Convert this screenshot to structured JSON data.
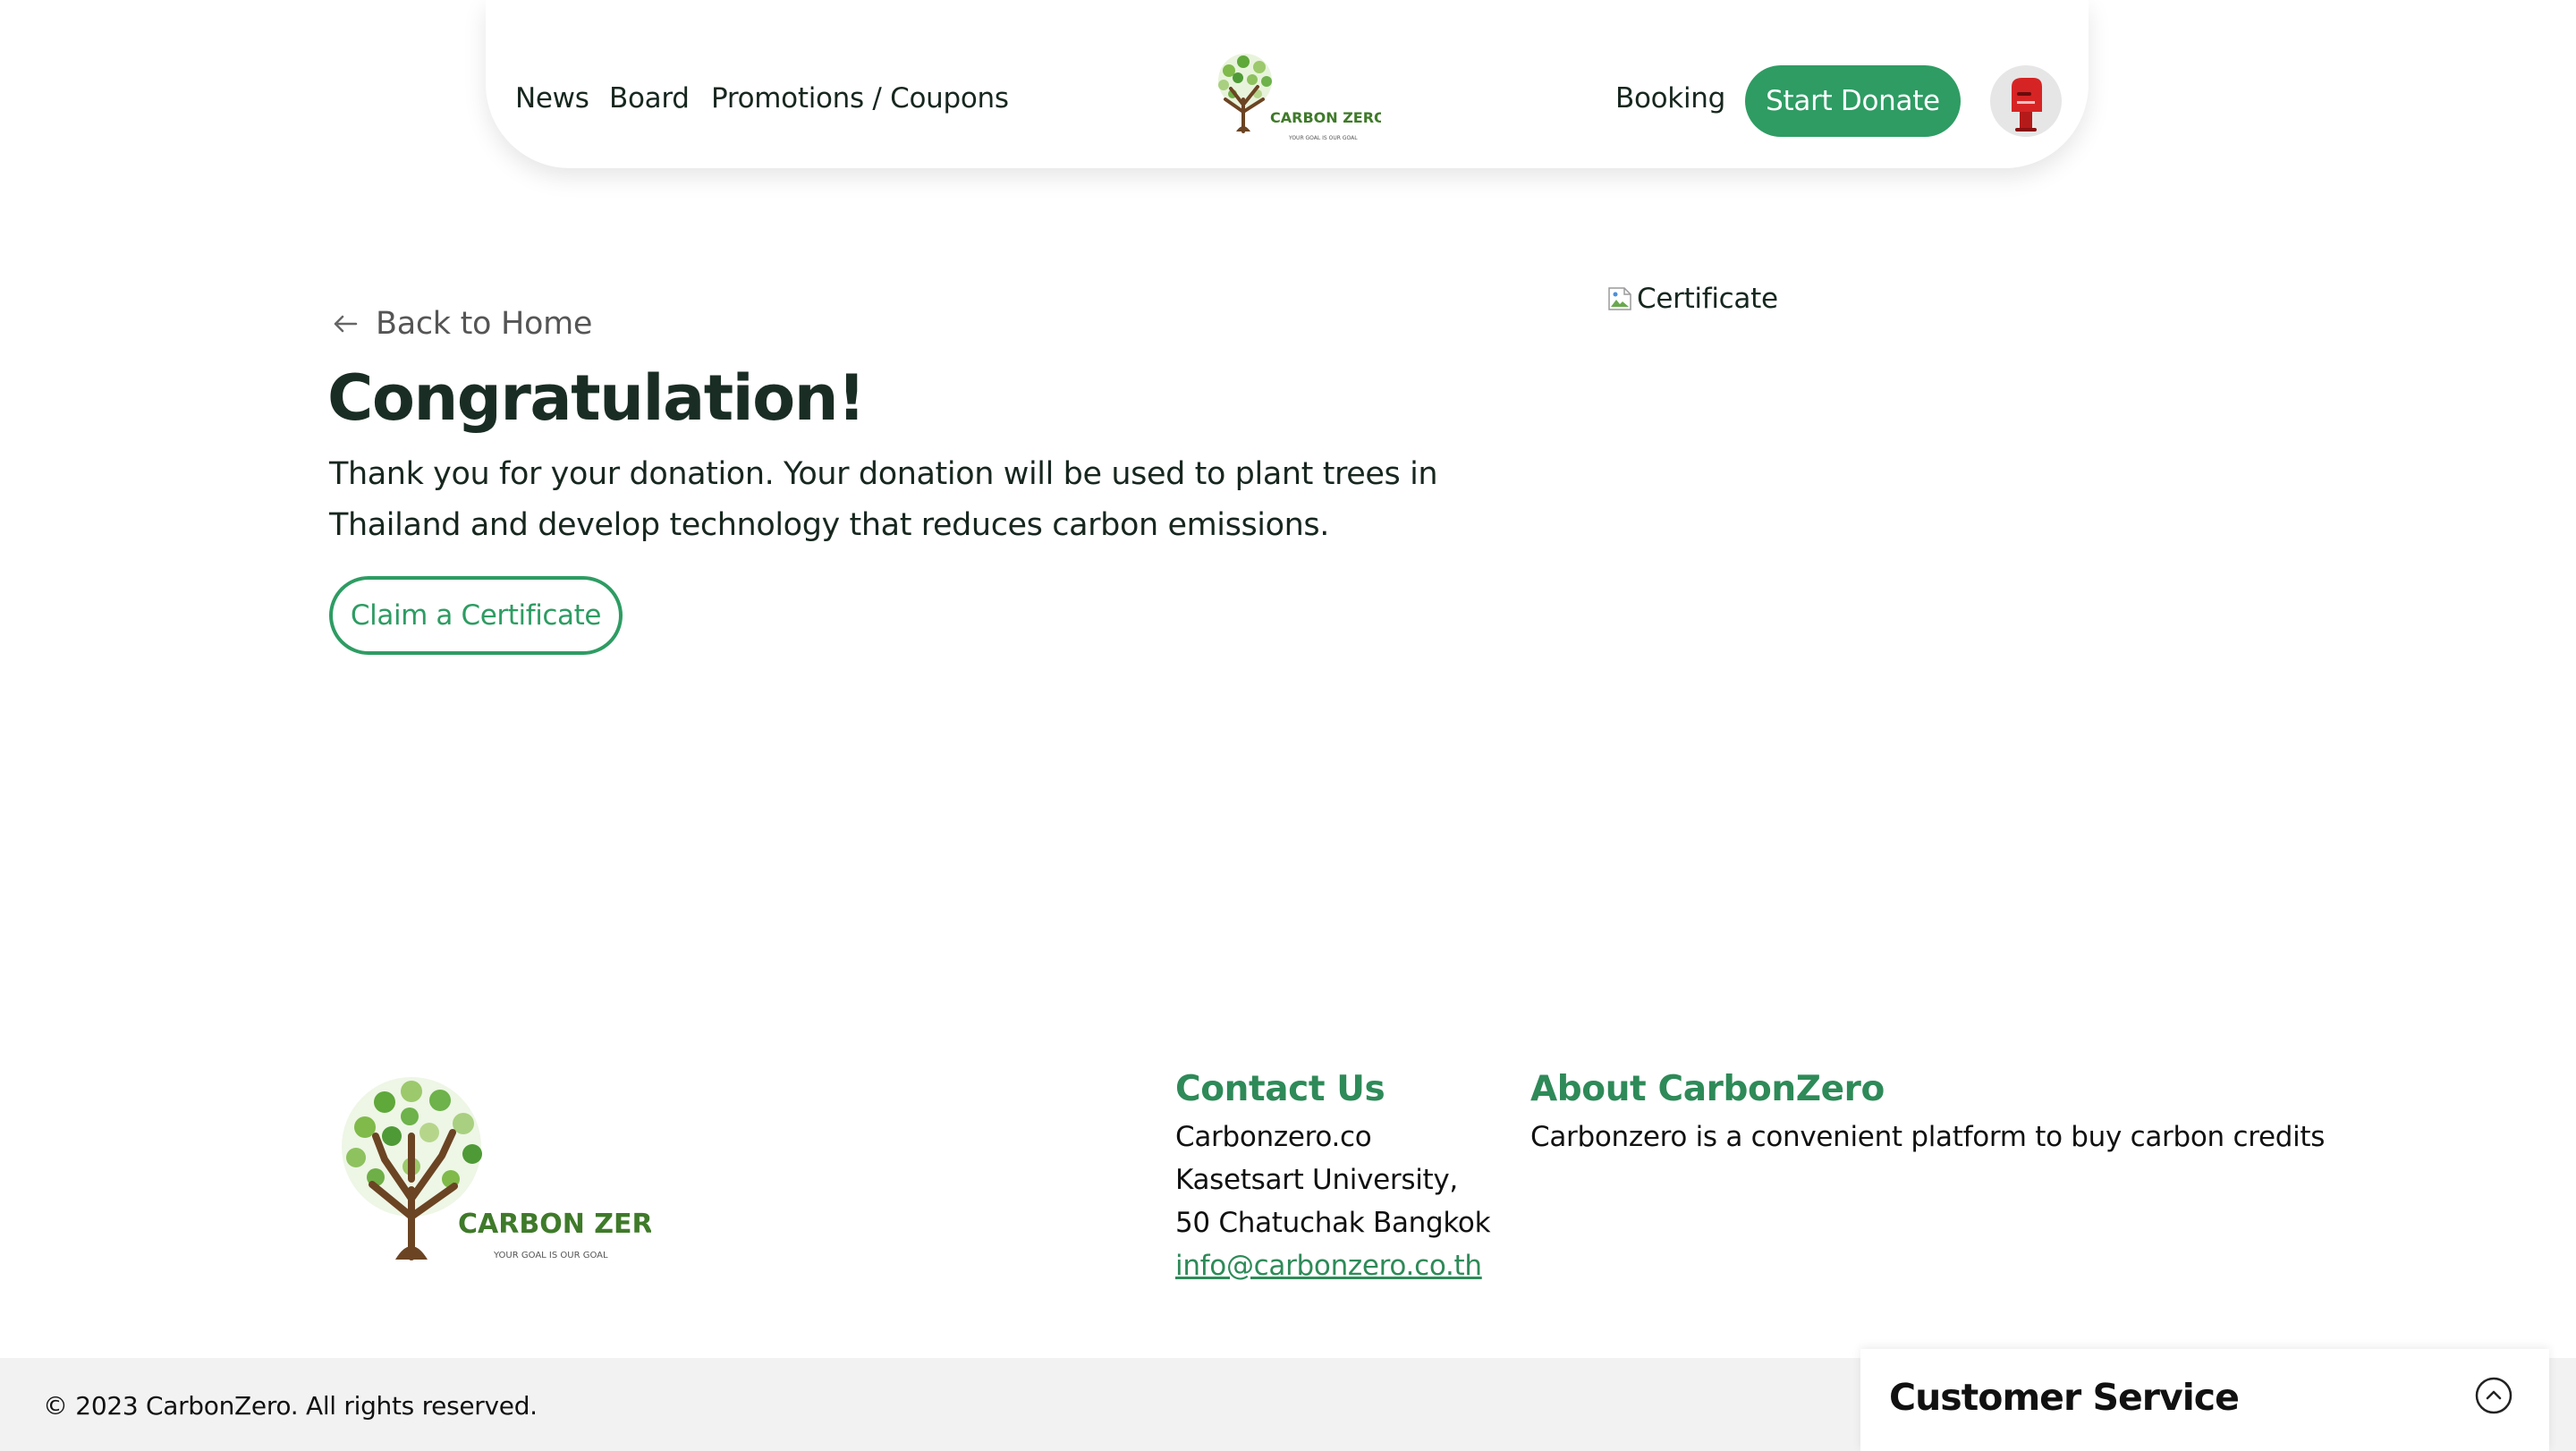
{
  "header": {
    "nav_left": [
      "News",
      "Board",
      "Promotions / Coupons"
    ],
    "nav_booking": "Booking",
    "donate_label": "Start Donate",
    "logo": {
      "brand": "CARBON ZERO",
      "tagline": "YOUR GOAL IS OUR GOAL",
      "icon": "tree-logo-icon"
    },
    "avatar_icon": "red-mailbox-avatar-icon"
  },
  "main": {
    "back_label": "Back to Home",
    "back_icon": "arrow-left-icon",
    "title": "Congratulation!",
    "description": "Thank you for your donation. Your donation will be used to plant trees in Thailand and develop technology that reduces carbon emissions.",
    "claim_label": "Claim a Certificate",
    "certificate_alt": "Certificate",
    "certificate_icon": "broken-image-icon"
  },
  "footer": {
    "logo": {
      "brand": "CARBON ZERO",
      "tagline": "YOUR GOAL IS OUR GOAL"
    },
    "contact": {
      "title": "Contact Us",
      "lines": [
        "Carbonzero.co",
        "Kasetsart University,",
        "50 Chatuchak Bangkok"
      ],
      "email": "info@carbonzero.co.th"
    },
    "about": {
      "title": "About CarbonZero",
      "text": "Carbonzero is a convenient platform to buy carbon credits"
    },
    "copyright": "© 2023 CarbonZero. All rights reserved."
  },
  "customer_service": {
    "title": "Customer Service",
    "toggle_icon": "chevron-up-circle-icon"
  },
  "colors": {
    "brand_green": "#2e9c63",
    "heading_dark": "#1a2d24",
    "footer_bar": "#f2f2f2",
    "logo_text_green": "#3f7a2a",
    "trunk_brown": "#6b4423"
  }
}
